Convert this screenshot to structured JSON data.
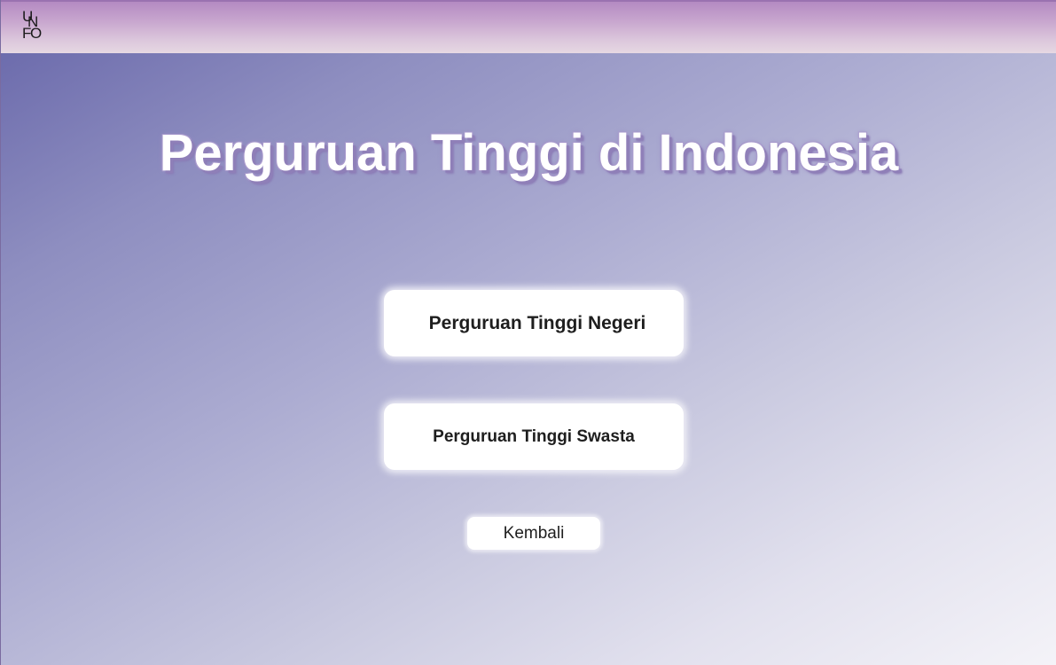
{
  "header": {
    "logo_letters": [
      "U",
      "N",
      "F",
      "O"
    ]
  },
  "main": {
    "title": "Perguruan Tinggi di Indonesia",
    "buttons": {
      "negeri": "Perguruan Tinggi Negeri",
      "swasta": "Perguruan Tinggi Swasta",
      "back": "Kembali"
    }
  },
  "colors": {
    "topbar_accent": "#b48ac2",
    "background_start": "#6564a8",
    "background_end": "#f4f3f8",
    "title_shadow": "#8f7fb8",
    "button_bg": "#ffffff"
  }
}
